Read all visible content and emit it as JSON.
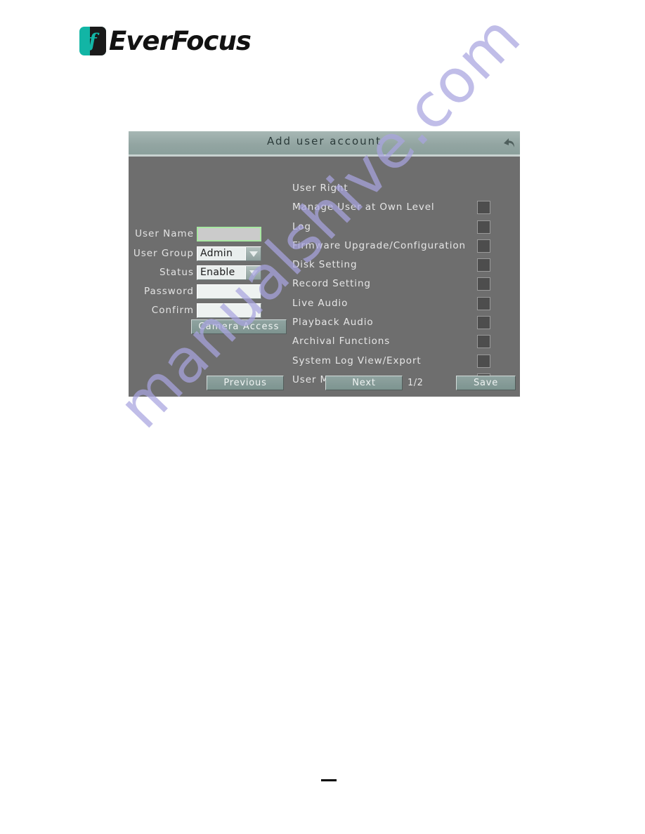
{
  "brand": {
    "name": "EverFocus",
    "mark_letter": "f",
    "teal": "#12b5a5",
    "dark": "#121212"
  },
  "watermark": {
    "text": "manualshive.com",
    "color": "#a9a5e0"
  },
  "dialog": {
    "title": "Add user account",
    "back_icon": "back-arrow-icon",
    "form": {
      "fields": [
        {
          "label": "User  Name",
          "type": "text",
          "value": "",
          "focused": true,
          "name": "user-name"
        },
        {
          "label": "User  Group",
          "type": "select",
          "value": "Admin",
          "focused": false,
          "name": "user-group"
        },
        {
          "label": "Status",
          "type": "select",
          "value": "Enable",
          "focused": false,
          "name": "status"
        },
        {
          "label": "Password",
          "type": "text",
          "value": "",
          "focused": false,
          "name": "password"
        },
        {
          "label": "Confirm",
          "type": "text",
          "value": "",
          "focused": false,
          "name": "confirm"
        }
      ],
      "camera_access_label": "Camera  Access"
    },
    "permissions": {
      "header": "User  Right",
      "rows": [
        {
          "label": "Manage  User  at  Own  Level",
          "checked": false
        },
        {
          "label": "Log",
          "checked": false
        },
        {
          "label": "Firmware  Upgrade/Configuration",
          "checked": false
        },
        {
          "label": "Disk  Setting",
          "checked": false
        },
        {
          "label": "Record  Setting",
          "checked": false
        },
        {
          "label": "Live  Audio",
          "checked": false
        },
        {
          "label": "Playback  Audio",
          "checked": false
        },
        {
          "label": "Archival  Functions",
          "checked": false
        },
        {
          "label": "System  Log  View/Export",
          "checked": false
        },
        {
          "label": "User  Management",
          "checked": false
        }
      ]
    },
    "footer": {
      "previous_label": "Previous",
      "next_label": "Next",
      "page_indicator": "1/2",
      "save_label": "Save"
    }
  }
}
